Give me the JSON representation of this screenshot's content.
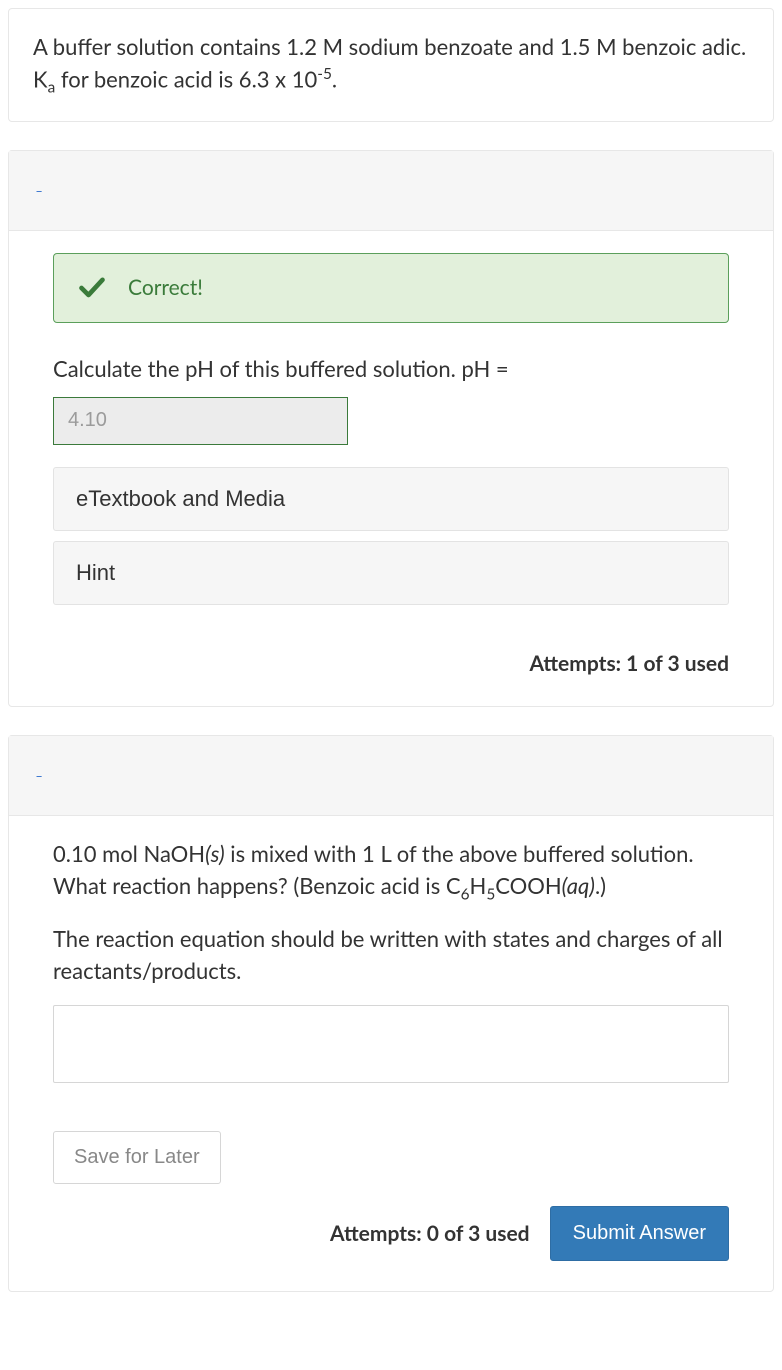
{
  "question": {
    "text_html": "A buffer solution contains 1.2 M sodium benzoate and 1.5 M benzoic adic. K<sub>a</sub> for benzoic acid is 6.3 x 10<sup>-5</sup>."
  },
  "part1": {
    "toggle": "-",
    "correct_label": "Correct!",
    "prompt": "Calculate the pH of this buffered solution. pH =",
    "answer_value": "4.10",
    "etextbook_label": "eTextbook and Media",
    "hint_label": "Hint",
    "attempts": "Attempts: 1 of 3 used"
  },
  "part2": {
    "toggle": "-",
    "prompt1_html": "0.10 mol NaOH<em>(s)</em> is mixed with 1 L of the above buffered solution. What reaction happens? (Benzoic acid is C<sub>6</sub>H<sub>5</sub>COOH<em>(aq)</em>.)",
    "prompt2": "The reaction equation should be written with states and charges of all reactants/products.",
    "reaction_value": "",
    "save_label": "Save for Later",
    "attempts": "Attempts: 0 of 3 used",
    "submit_label": "Submit Answer"
  }
}
